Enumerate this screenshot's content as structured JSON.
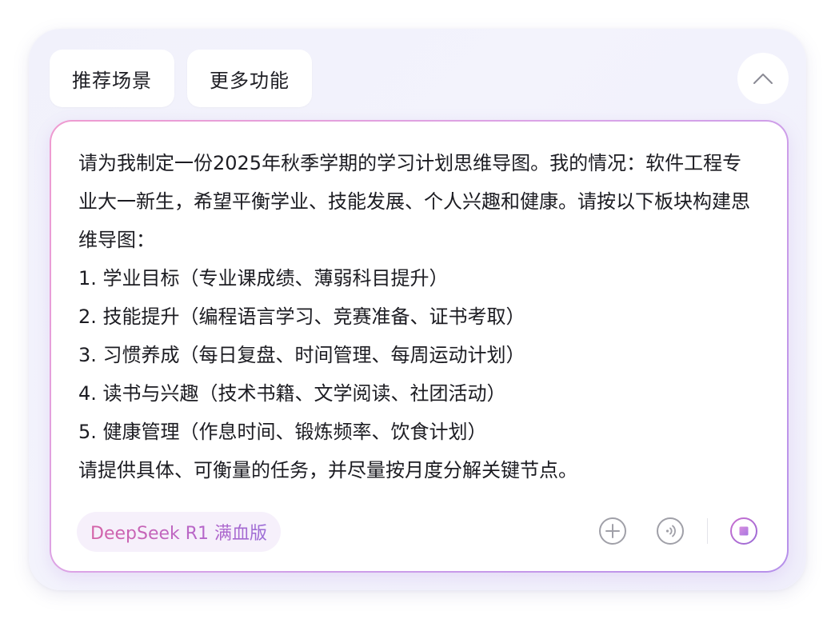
{
  "chips": [
    {
      "label": "推荐场景"
    },
    {
      "label": "更多功能"
    }
  ],
  "prompt": {
    "text": "请为我制定一份2025年秋季学期的学习计划思维导图。我的情况：软件工程专业大一新生，希望平衡学业、技能发展、个人兴趣和健康。请按以下板块构建思维导图：\n1. 学业目标（专业课成绩、薄弱科目提升）\n2. 技能提升（编程语言学习、竞赛准备、证书考取）\n3. 习惯养成（每日复盘、时间管理、每周运动计划）\n4. 读书与兴趣（技术书籍、文学阅读、社团活动）\n5. 健康管理（作息时间、锻炼频率、饮食计划）\n请提供具体、可衡量的任务，并尽量按月度分解关键节点。"
  },
  "model": {
    "label": "DeepSeek R1 满血版"
  },
  "icons": {
    "collapse": "chevron-up-icon",
    "add": "plus-circle-icon",
    "voice": "voice-wave-icon",
    "stop": "stop-icon"
  },
  "colors": {
    "accent_pink": "#d462a7",
    "accent_purple": "#a173e0",
    "stop_square": "#c48ae8"
  }
}
